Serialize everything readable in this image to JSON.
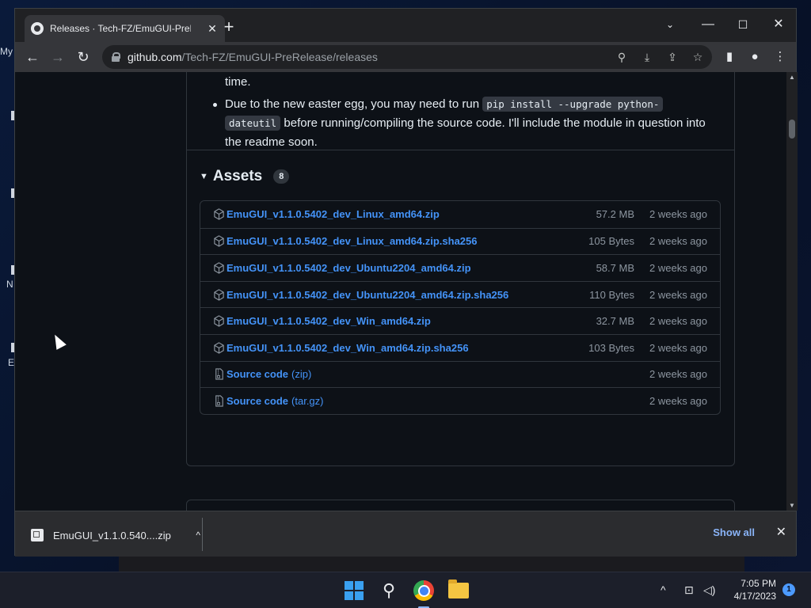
{
  "desktop": {
    "icon_labels": [
      "My",
      "N",
      "E"
    ]
  },
  "browser": {
    "tab_title": "Releases · Tech-FZ/EmuGUI-PreRe",
    "url_host": "github.com",
    "url_path": "/Tech-FZ/EmuGUI-PreRelease/releases"
  },
  "release": {
    "notes_fragment": "time.",
    "bullet_text_1": "Due to the new easter egg, you may need to run ",
    "bullet_code_1": "pip install --upgrade python-",
    "bullet_code_2": "dateutil",
    "bullet_text_2": " before running/compiling the source code. I'll include the module in question into the readme soon."
  },
  "assets": {
    "title": "Assets",
    "count": "8",
    "items": [
      {
        "name": "EmuGUI_v1.1.0.5402_dev_Linux_amd64.zip",
        "ext": "",
        "size": "57.2 MB",
        "date": "2 weeks ago",
        "icon": "package-icon"
      },
      {
        "name": "EmuGUI_v1.1.0.5402_dev_Linux_amd64.zip.sha256",
        "ext": "",
        "size": "105 Bytes",
        "date": "2 weeks ago",
        "icon": "package-icon"
      },
      {
        "name": "EmuGUI_v1.1.0.5402_dev_Ubuntu2204_amd64.zip",
        "ext": "",
        "size": "58.7 MB",
        "date": "2 weeks ago",
        "icon": "package-icon"
      },
      {
        "name": "EmuGUI_v1.1.0.5402_dev_Ubuntu2204_amd64.zip.sha256",
        "ext": "",
        "size": "110 Bytes",
        "date": "2 weeks ago",
        "icon": "package-icon"
      },
      {
        "name": "EmuGUI_v1.1.0.5402_dev_Win_amd64.zip",
        "ext": "",
        "size": "32.7 MB",
        "date": "2 weeks ago",
        "icon": "package-icon"
      },
      {
        "name": "EmuGUI_v1.1.0.5402_dev_Win_amd64.zip.sha256",
        "ext": "",
        "size": "103 Bytes",
        "date": "2 weeks ago",
        "icon": "package-icon"
      },
      {
        "name": "Source code",
        "ext": "(zip)",
        "size": "",
        "date": "2 weeks ago",
        "icon": "file-zip-icon"
      },
      {
        "name": "Source code",
        "ext": "(tar.gz)",
        "size": "",
        "date": "2 weeks ago",
        "icon": "file-zip-icon"
      }
    ]
  },
  "download_bar": {
    "file_name": "EmuGUI_v1.1.0.540....zip",
    "show_all": "Show all"
  },
  "taskbar": {
    "time": "7:05 PM",
    "date": "4/17/2023",
    "notification_count": "1"
  },
  "colors": {
    "link": "#4493f8",
    "page_bg": "#0d1117",
    "border": "#30363d"
  }
}
